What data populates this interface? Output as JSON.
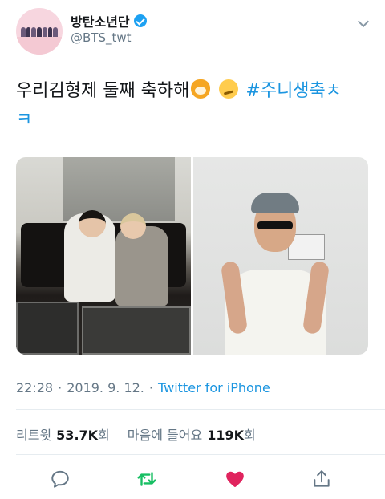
{
  "user": {
    "display_name": "방탄소년단",
    "handle": "@BTS_twt",
    "verified": true
  },
  "tweet": {
    "text": "우리김형제 둘째 축하해",
    "emojis": [
      "tiger-face-icon",
      "woozy-face-icon"
    ],
    "hashtag_line1": "#주니생축ㅊ",
    "hashtag_line2": "ㅋ"
  },
  "photos": [
    {
      "name": "photo-two-members-on-sofa"
    },
    {
      "name": "photo-member-with-sunglasses"
    }
  ],
  "meta": {
    "time": "22:28",
    "separator1": "·",
    "date": "2019. 9. 12.",
    "separator2": "·",
    "source": "Twitter for iPhone"
  },
  "stats": {
    "retweets_label": "리트윗",
    "retweets_value": "53.7K",
    "retweets_suffix": "회",
    "likes_label": "마음에 들어요",
    "likes_value": "119K",
    "likes_suffix": "회"
  },
  "actions": [
    "reply-icon",
    "retweet-icon",
    "like-icon",
    "share-icon"
  ],
  "colors": {
    "accent": "#1b95e0",
    "retweet": "#17bf63",
    "like": "#e0245e",
    "secondary_text": "#657786"
  }
}
